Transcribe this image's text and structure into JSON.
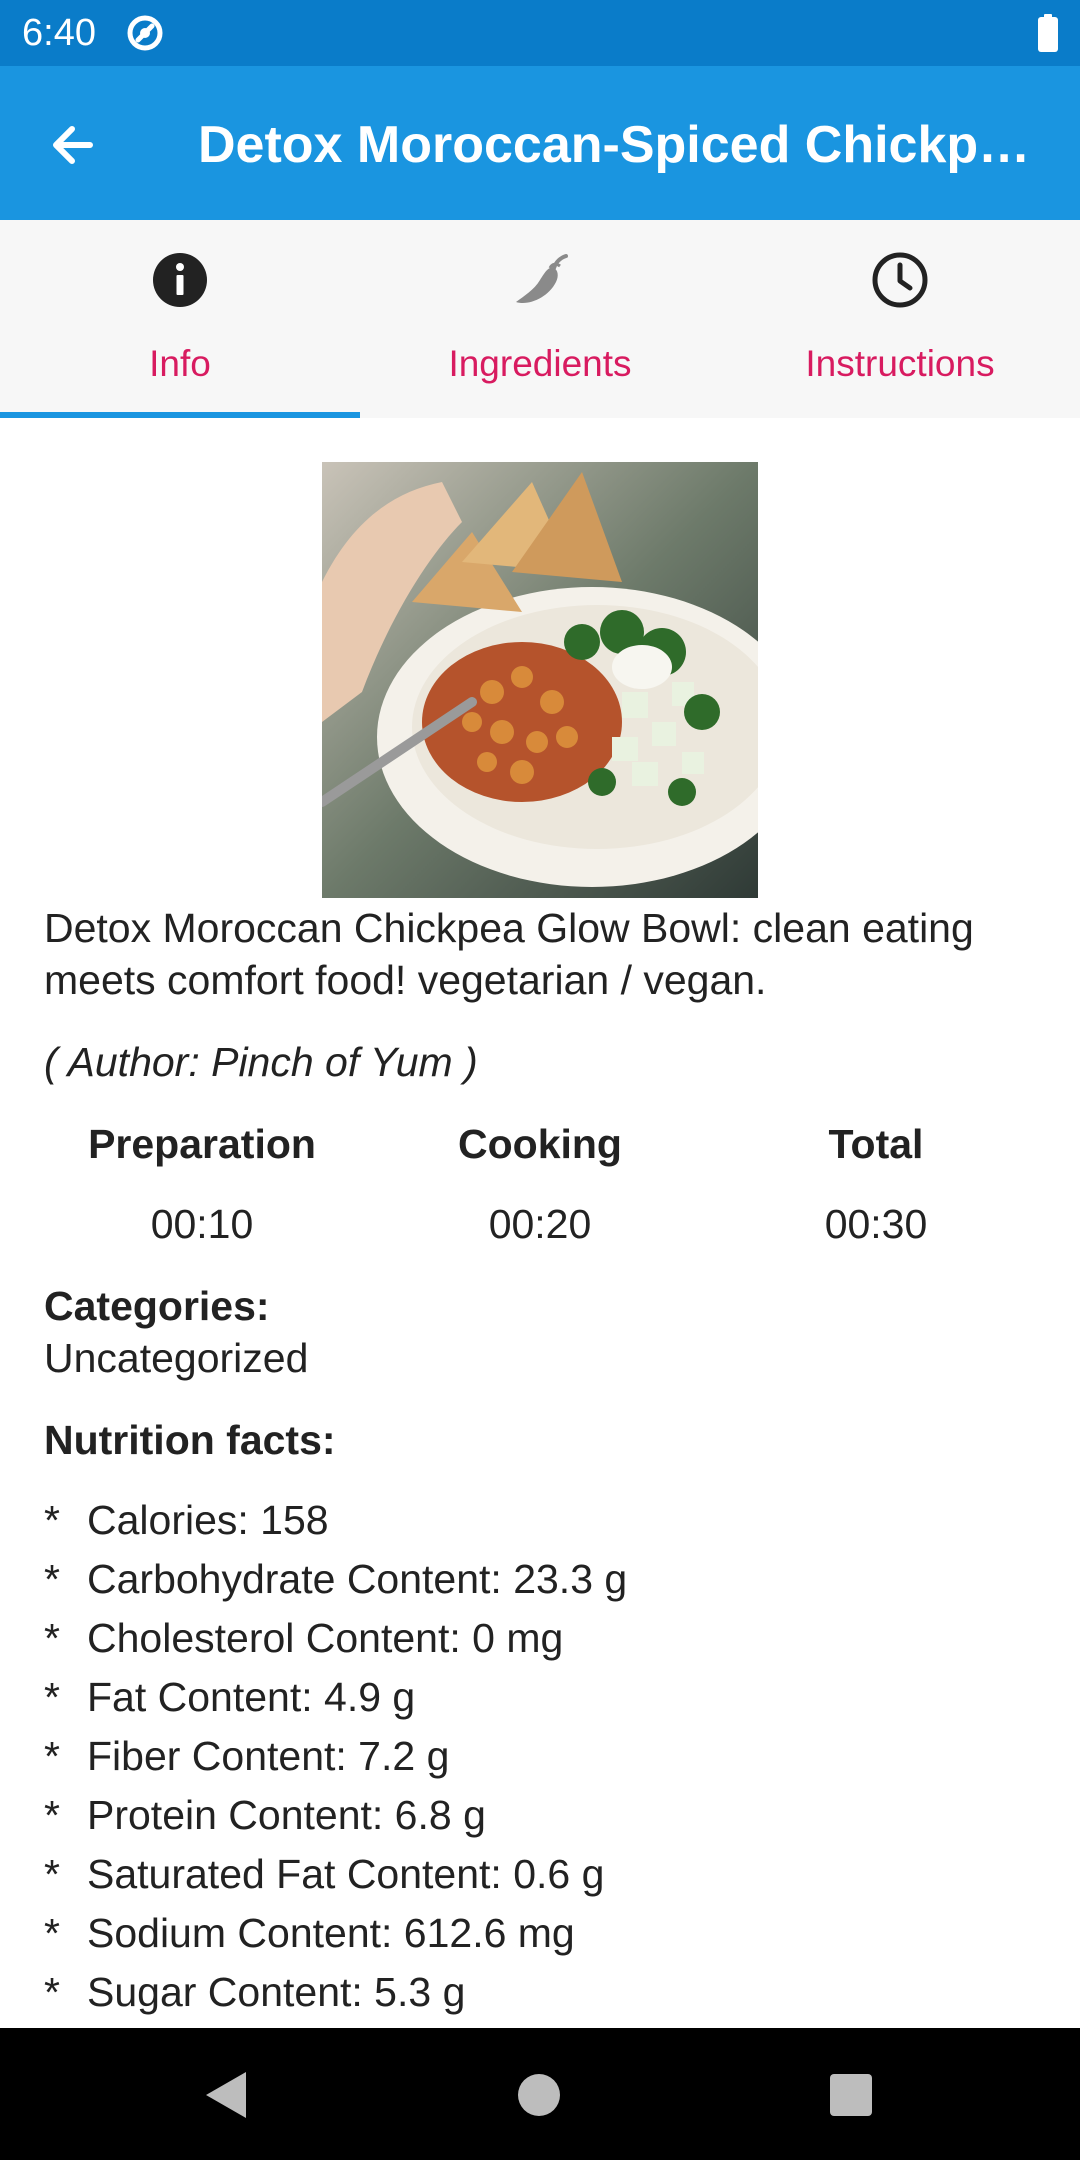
{
  "status_bar": {
    "time": "6:40",
    "icons": [
      "vpn-icon",
      "battery-icon"
    ]
  },
  "app_bar": {
    "title": "Detox Moroccan-Spiced Chickpea Glow Bowl",
    "back_icon": "arrow-back-icon",
    "color": "#1a95e0"
  },
  "tabs": [
    {
      "label": "Info",
      "icon": "info-icon",
      "selected": true
    },
    {
      "label": "Ingredients",
      "icon": "chili-pepper-icon",
      "selected": false
    },
    {
      "label": "Instructions",
      "icon": "clock-icon",
      "selected": false
    }
  ],
  "recipe": {
    "description": "Detox Moroccan Chickpea Glow Bowl: clean eating meets comfort food! vegetarian / vegan.",
    "author": "( Author: Pinch of Yum )",
    "times": [
      {
        "label": "Preparation",
        "value": "00:10"
      },
      {
        "label": "Cooking",
        "value": "00:20"
      },
      {
        "label": "Total",
        "value": "00:30"
      }
    ],
    "categories_label": "Categories:",
    "categories_value": "Uncategorized",
    "nutrition_label": "Nutrition facts:",
    "nutrition_bullet": "*",
    "nutrition": [
      "Calories: 158",
      "Carbohydrate Content: 23.3 g",
      "Cholesterol Content: 0 mg",
      "Fat Content: 4.9 g",
      "Fiber Content: 7.2 g",
      "Protein Content: 6.8 g",
      "Saturated Fat Content: 0.6 g",
      "Sodium Content: 612.6 mg",
      "Sugar Content: 5.3 g"
    ]
  },
  "colors": {
    "status_bar": "#0a7cc9",
    "accent": "#d81b60",
    "indicator": "#1a95e0"
  },
  "nav_bar": {
    "icons": [
      "nav-back-icon",
      "nav-home-icon",
      "nav-recents-icon"
    ]
  }
}
